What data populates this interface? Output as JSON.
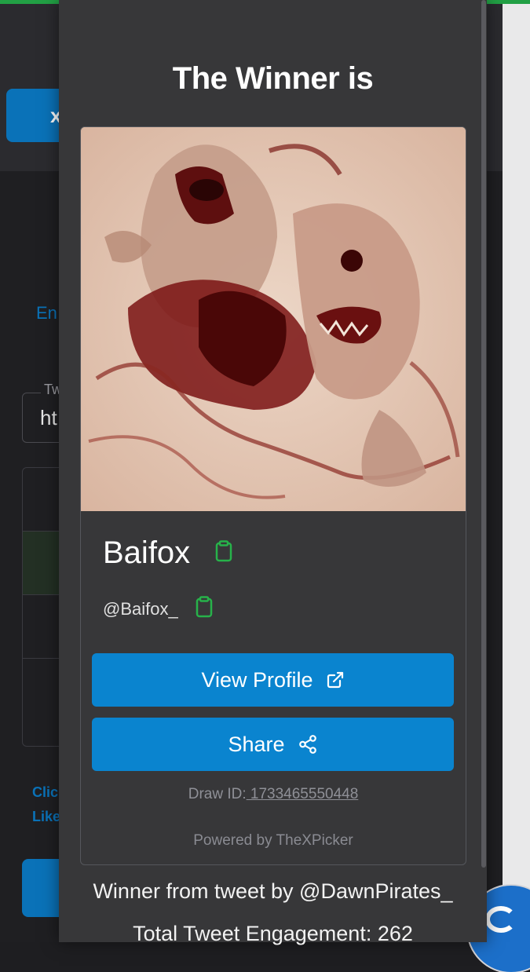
{
  "background": {
    "x_button_label": "x",
    "link_text": "En",
    "field_label": "Tw",
    "field_value": "ht",
    "footer_line1": "Clic",
    "footer_line2": "Like"
  },
  "modal": {
    "title": "The Winner is",
    "winner": {
      "name": "Baifox",
      "handle": "@Baifox_",
      "avatar_icon": "winner-avatar-image"
    },
    "buttons": {
      "view_profile": "View Profile",
      "share": "Share"
    },
    "draw_id_label": "Draw ID:",
    "draw_id": " 1733465550448",
    "powered_by": "Powered by TheXPicker",
    "tweet_by": "Winner from tweet by @DawnPirates_",
    "engagement": "Total Tweet Engagement: 262"
  },
  "colors": {
    "accent": "#0a84cf",
    "copy_icon": "#27b24a",
    "modal_bg": "#373739"
  }
}
